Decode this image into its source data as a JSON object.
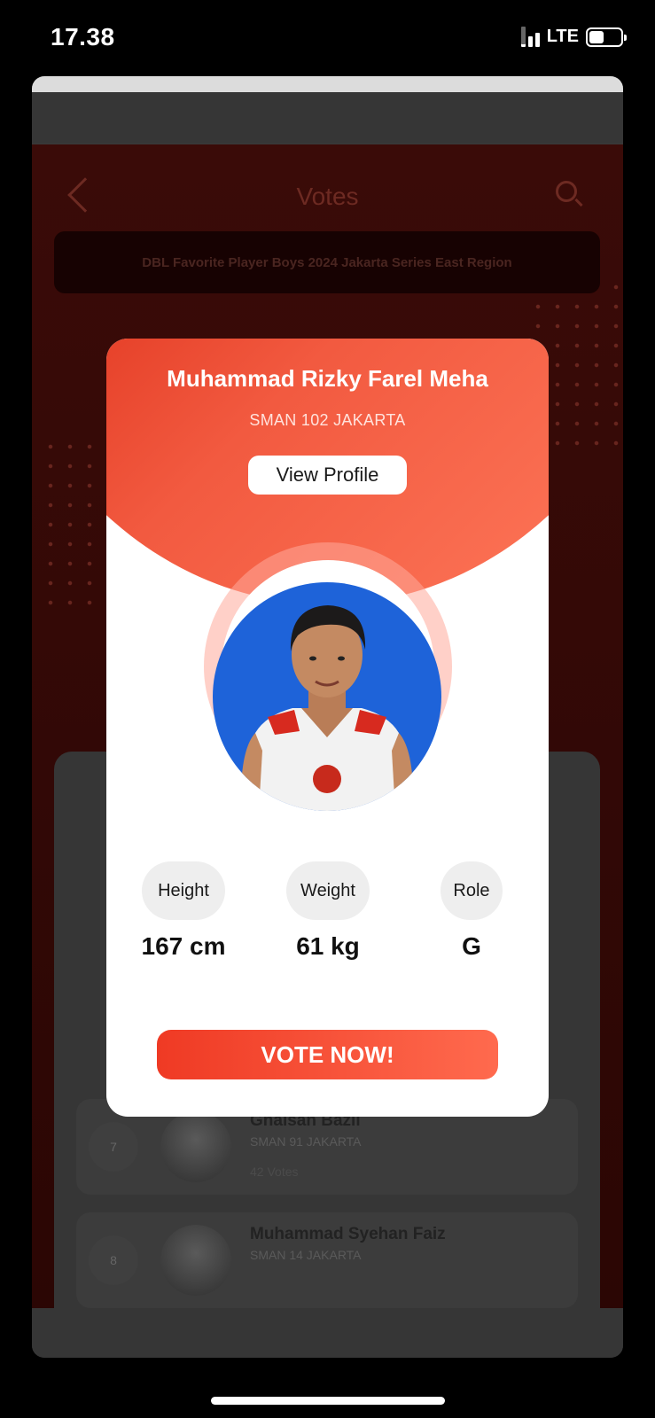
{
  "status_bar": {
    "time": "17.38",
    "network": "LTE",
    "battery_level": 0.48
  },
  "app": {
    "title": "Votes",
    "back_icon": "chevron-left-icon",
    "search_icon": "search-icon",
    "event_name": "DBL Favorite Player Boys 2024 Jakarta Series East Region",
    "list": [
      {
        "rank": "7",
        "name": "Ghaisan Bazil",
        "school": "SMAN 91 JAKARTA",
        "votes": "42 Votes"
      },
      {
        "rank": "8",
        "name": "Muhammad Syehan Faiz",
        "school": "SMAN 14 JAKARTA",
        "votes": ""
      }
    ]
  },
  "modal": {
    "player_name": "Muhammad Rizky Farel Meha",
    "school": "SMAN 102 JAKARTA",
    "view_profile_label": "View Profile",
    "stats": [
      {
        "label": "Height",
        "value": "167 cm"
      },
      {
        "label": "Weight",
        "value": "61 kg"
      },
      {
        "label": "Role",
        "value": "G"
      }
    ],
    "vote_label": "VOTE NOW!",
    "colors": {
      "hero_start": "#d41b07",
      "hero_end": "#ff7a5c",
      "avatar_bg": "#1e63d9"
    }
  }
}
